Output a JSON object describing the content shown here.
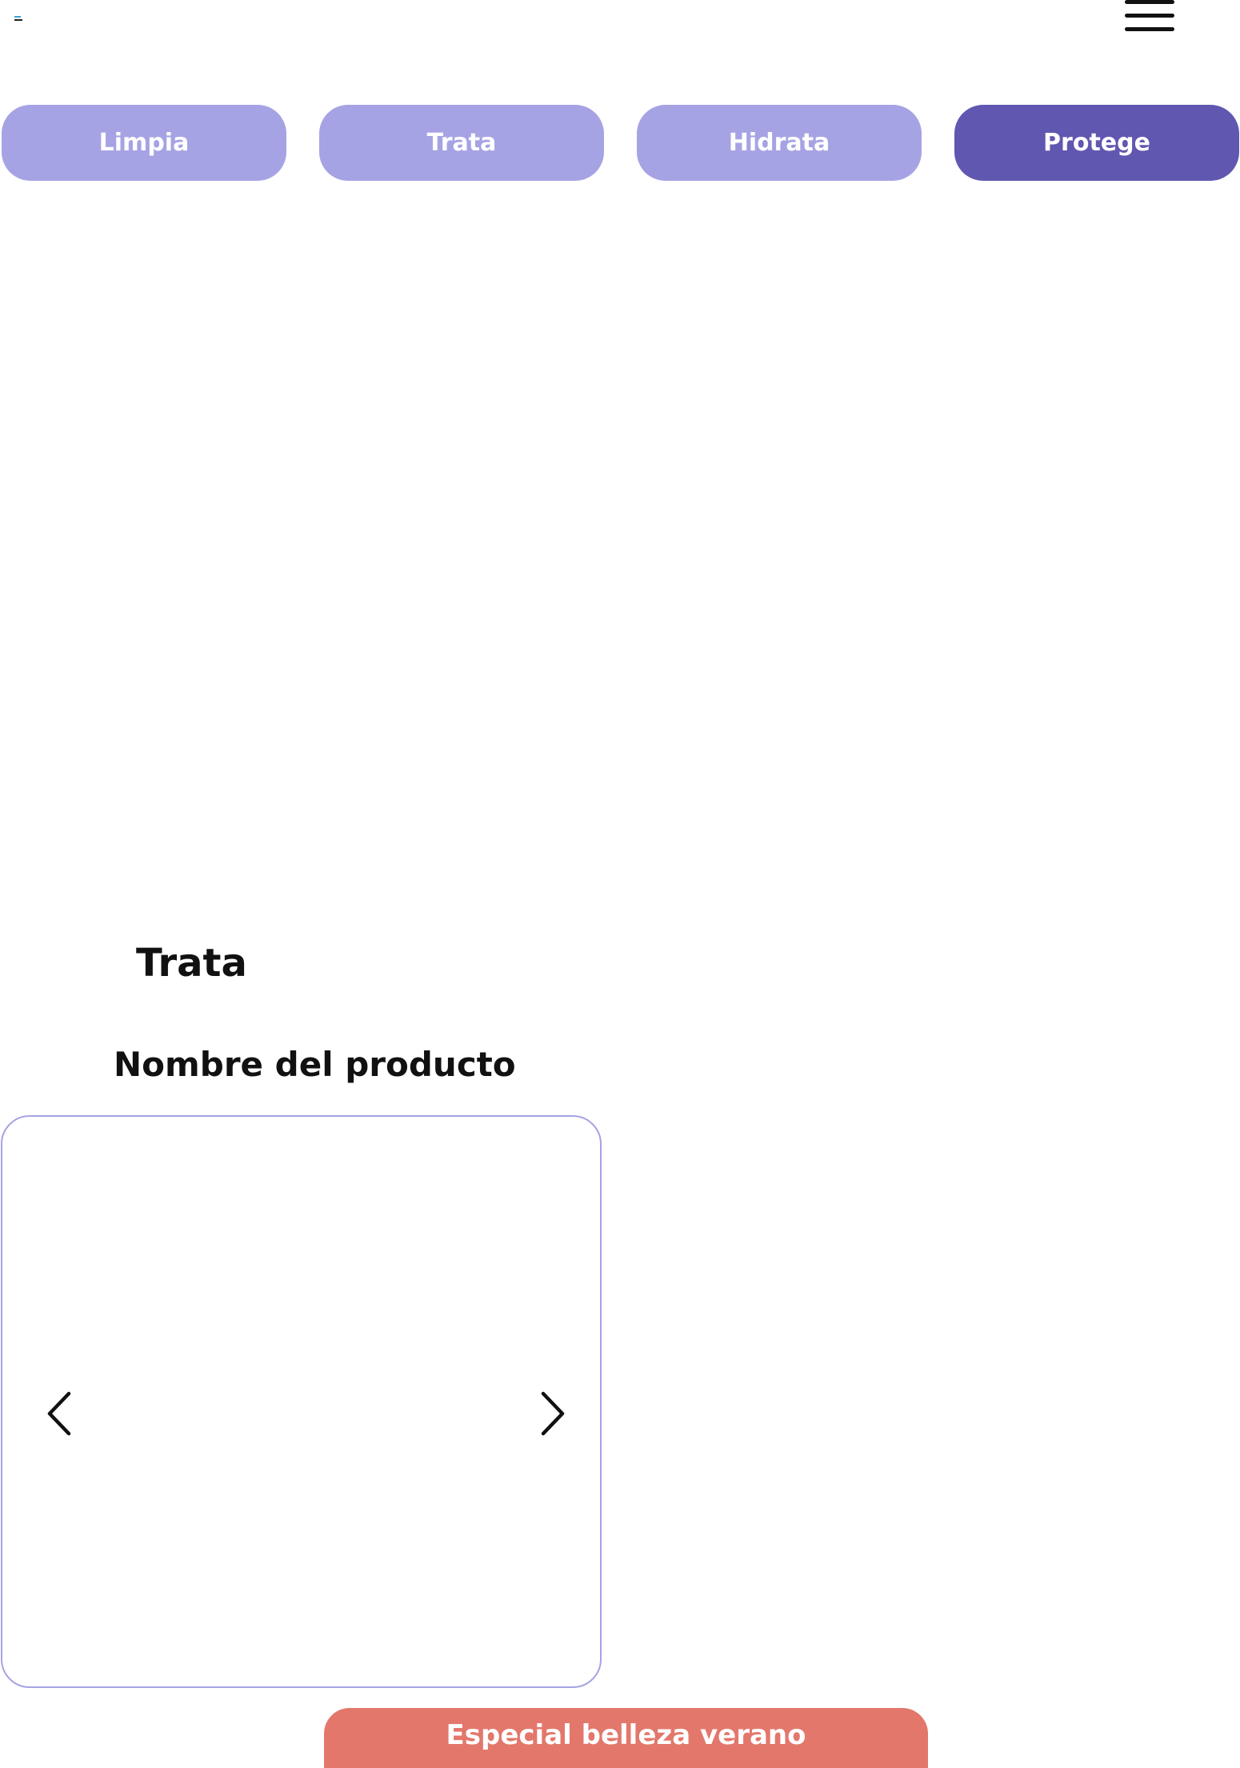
{
  "header": {
    "logo_icon": "logo-icon",
    "menu_icon": "hamburger-menu-icon"
  },
  "tabs": [
    {
      "label": "Limpia",
      "active": false
    },
    {
      "label": "Trata",
      "active": false
    },
    {
      "label": "Hidrata",
      "active": false
    },
    {
      "label": "Protege",
      "active": true
    }
  ],
  "section": {
    "title": "Trata",
    "product_name": "Nombre del producto"
  },
  "carousel": {
    "prev_icon": "chevron-left-icon",
    "next_icon": "chevron-right-icon"
  },
  "promo": {
    "label": "Especial belleza verano"
  },
  "colors": {
    "tab_inactive": "#a6a3e4",
    "tab_active": "#6057b1",
    "promo": "#e3776c",
    "text": "#111111"
  }
}
